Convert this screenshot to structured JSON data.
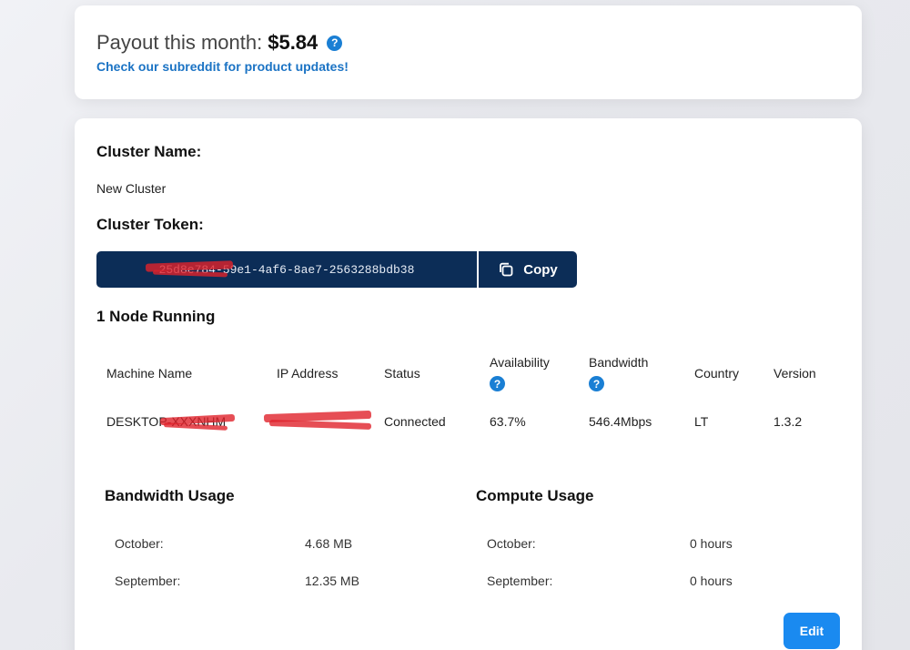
{
  "payout": {
    "label": "Payout this month:",
    "amount": "$5.84",
    "help_glyph": "?",
    "subreddit_link": "Check our subreddit for product updates!"
  },
  "cluster": {
    "name_heading": "Cluster Name:",
    "name_value": "New Cluster",
    "token_heading": "Cluster Token:",
    "token_value": "25d8e784-59e1-4af6-8ae7-2563288bdb38",
    "copy_label": "Copy",
    "nodes_heading": "1 Node Running"
  },
  "nodes_table": {
    "columns": [
      "Machine Name",
      "IP Address",
      "Status",
      "Availability",
      "Bandwidth",
      "Country",
      "Version"
    ],
    "rows": [
      {
        "machine_name": "DESKTOP-XXXNHM",
        "ip_address": "",
        "status": "Connected",
        "availability": "63.7%",
        "bandwidth": "546.4Mbps",
        "country": "LT",
        "version": "1.3.2"
      }
    ]
  },
  "bandwidth_usage": {
    "heading": "Bandwidth Usage",
    "rows": [
      {
        "month": "October:",
        "value": "4.68 MB"
      },
      {
        "month": "September:",
        "value": "12.35 MB"
      }
    ]
  },
  "compute_usage": {
    "heading": "Compute Usage",
    "rows": [
      {
        "month": "October:",
        "value": "0 hours"
      },
      {
        "month": "September:",
        "value": "0 hours"
      }
    ]
  },
  "actions": {
    "edit_label": "Edit"
  },
  "colors": {
    "accent": "#1a7fd4",
    "token_bg": "#0c2d57",
    "edit_button": "#1a8af0",
    "link": "#1b73c4",
    "redaction": "#e0222a"
  },
  "icons": [
    "help-icon",
    "copy-icon"
  ]
}
